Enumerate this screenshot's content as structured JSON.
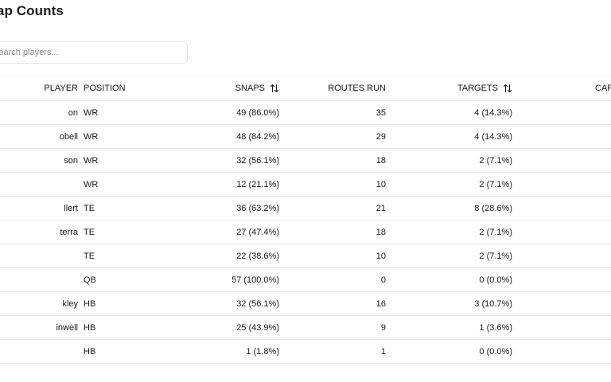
{
  "page": {
    "title": "Snap Counts"
  },
  "search": {
    "placeholder": "Search players..."
  },
  "table": {
    "columns": {
      "player": "PLAYER",
      "position": "POSITION",
      "snaps": "SNAPS",
      "routes": "ROUTES RUN",
      "targets": "TARGETS",
      "extra": "CAR"
    },
    "rows": [
      {
        "player": "on",
        "position": "WR",
        "snaps": "49 (86.0%)",
        "routes": "35",
        "targets": "4 (14.3%)"
      },
      {
        "player": "obell",
        "position": "WR",
        "snaps": "48 (84.2%)",
        "routes": "29",
        "targets": "4 (14.3%)"
      },
      {
        "player": "son",
        "position": "WR",
        "snaps": "32 (56.1%)",
        "routes": "18",
        "targets": "2 (7.1%)"
      },
      {
        "player": "",
        "position": "WR",
        "snaps": "12 (21.1%)",
        "routes": "10",
        "targets": "2 (7.1%)"
      },
      {
        "player": "llert",
        "position": "TE",
        "snaps": "36 (63.2%)",
        "routes": "21",
        "targets": "8 (28.6%)"
      },
      {
        "player": "terra",
        "position": "TE",
        "snaps": "27 (47.4%)",
        "routes": "18",
        "targets": "2 (7.1%)"
      },
      {
        "player": "",
        "position": "TE",
        "snaps": "22 (38.6%)",
        "routes": "10",
        "targets": "2 (7.1%)"
      },
      {
        "player": "",
        "position": "QB",
        "snaps": "57 (100.0%)",
        "routes": "0",
        "targets": "0 (0.0%)"
      },
      {
        "player": "kley",
        "position": "HB",
        "snaps": "32 (56.1%)",
        "routes": "16",
        "targets": "3 (10.7%)"
      },
      {
        "player": "inwell",
        "position": "HB",
        "snaps": "25 (43.9%)",
        "routes": "9",
        "targets": "1 (3.6%)"
      },
      {
        "player": "",
        "position": "HB",
        "snaps": "1 (1.8%)",
        "routes": "1",
        "targets": "0 (0.0%)"
      }
    ]
  },
  "icons": {
    "sort": "sort-arrows-icon"
  },
  "colors": {
    "text": "#1a1a1a",
    "border": "#e8e8e8",
    "placeholder": "#8a8a8a"
  }
}
